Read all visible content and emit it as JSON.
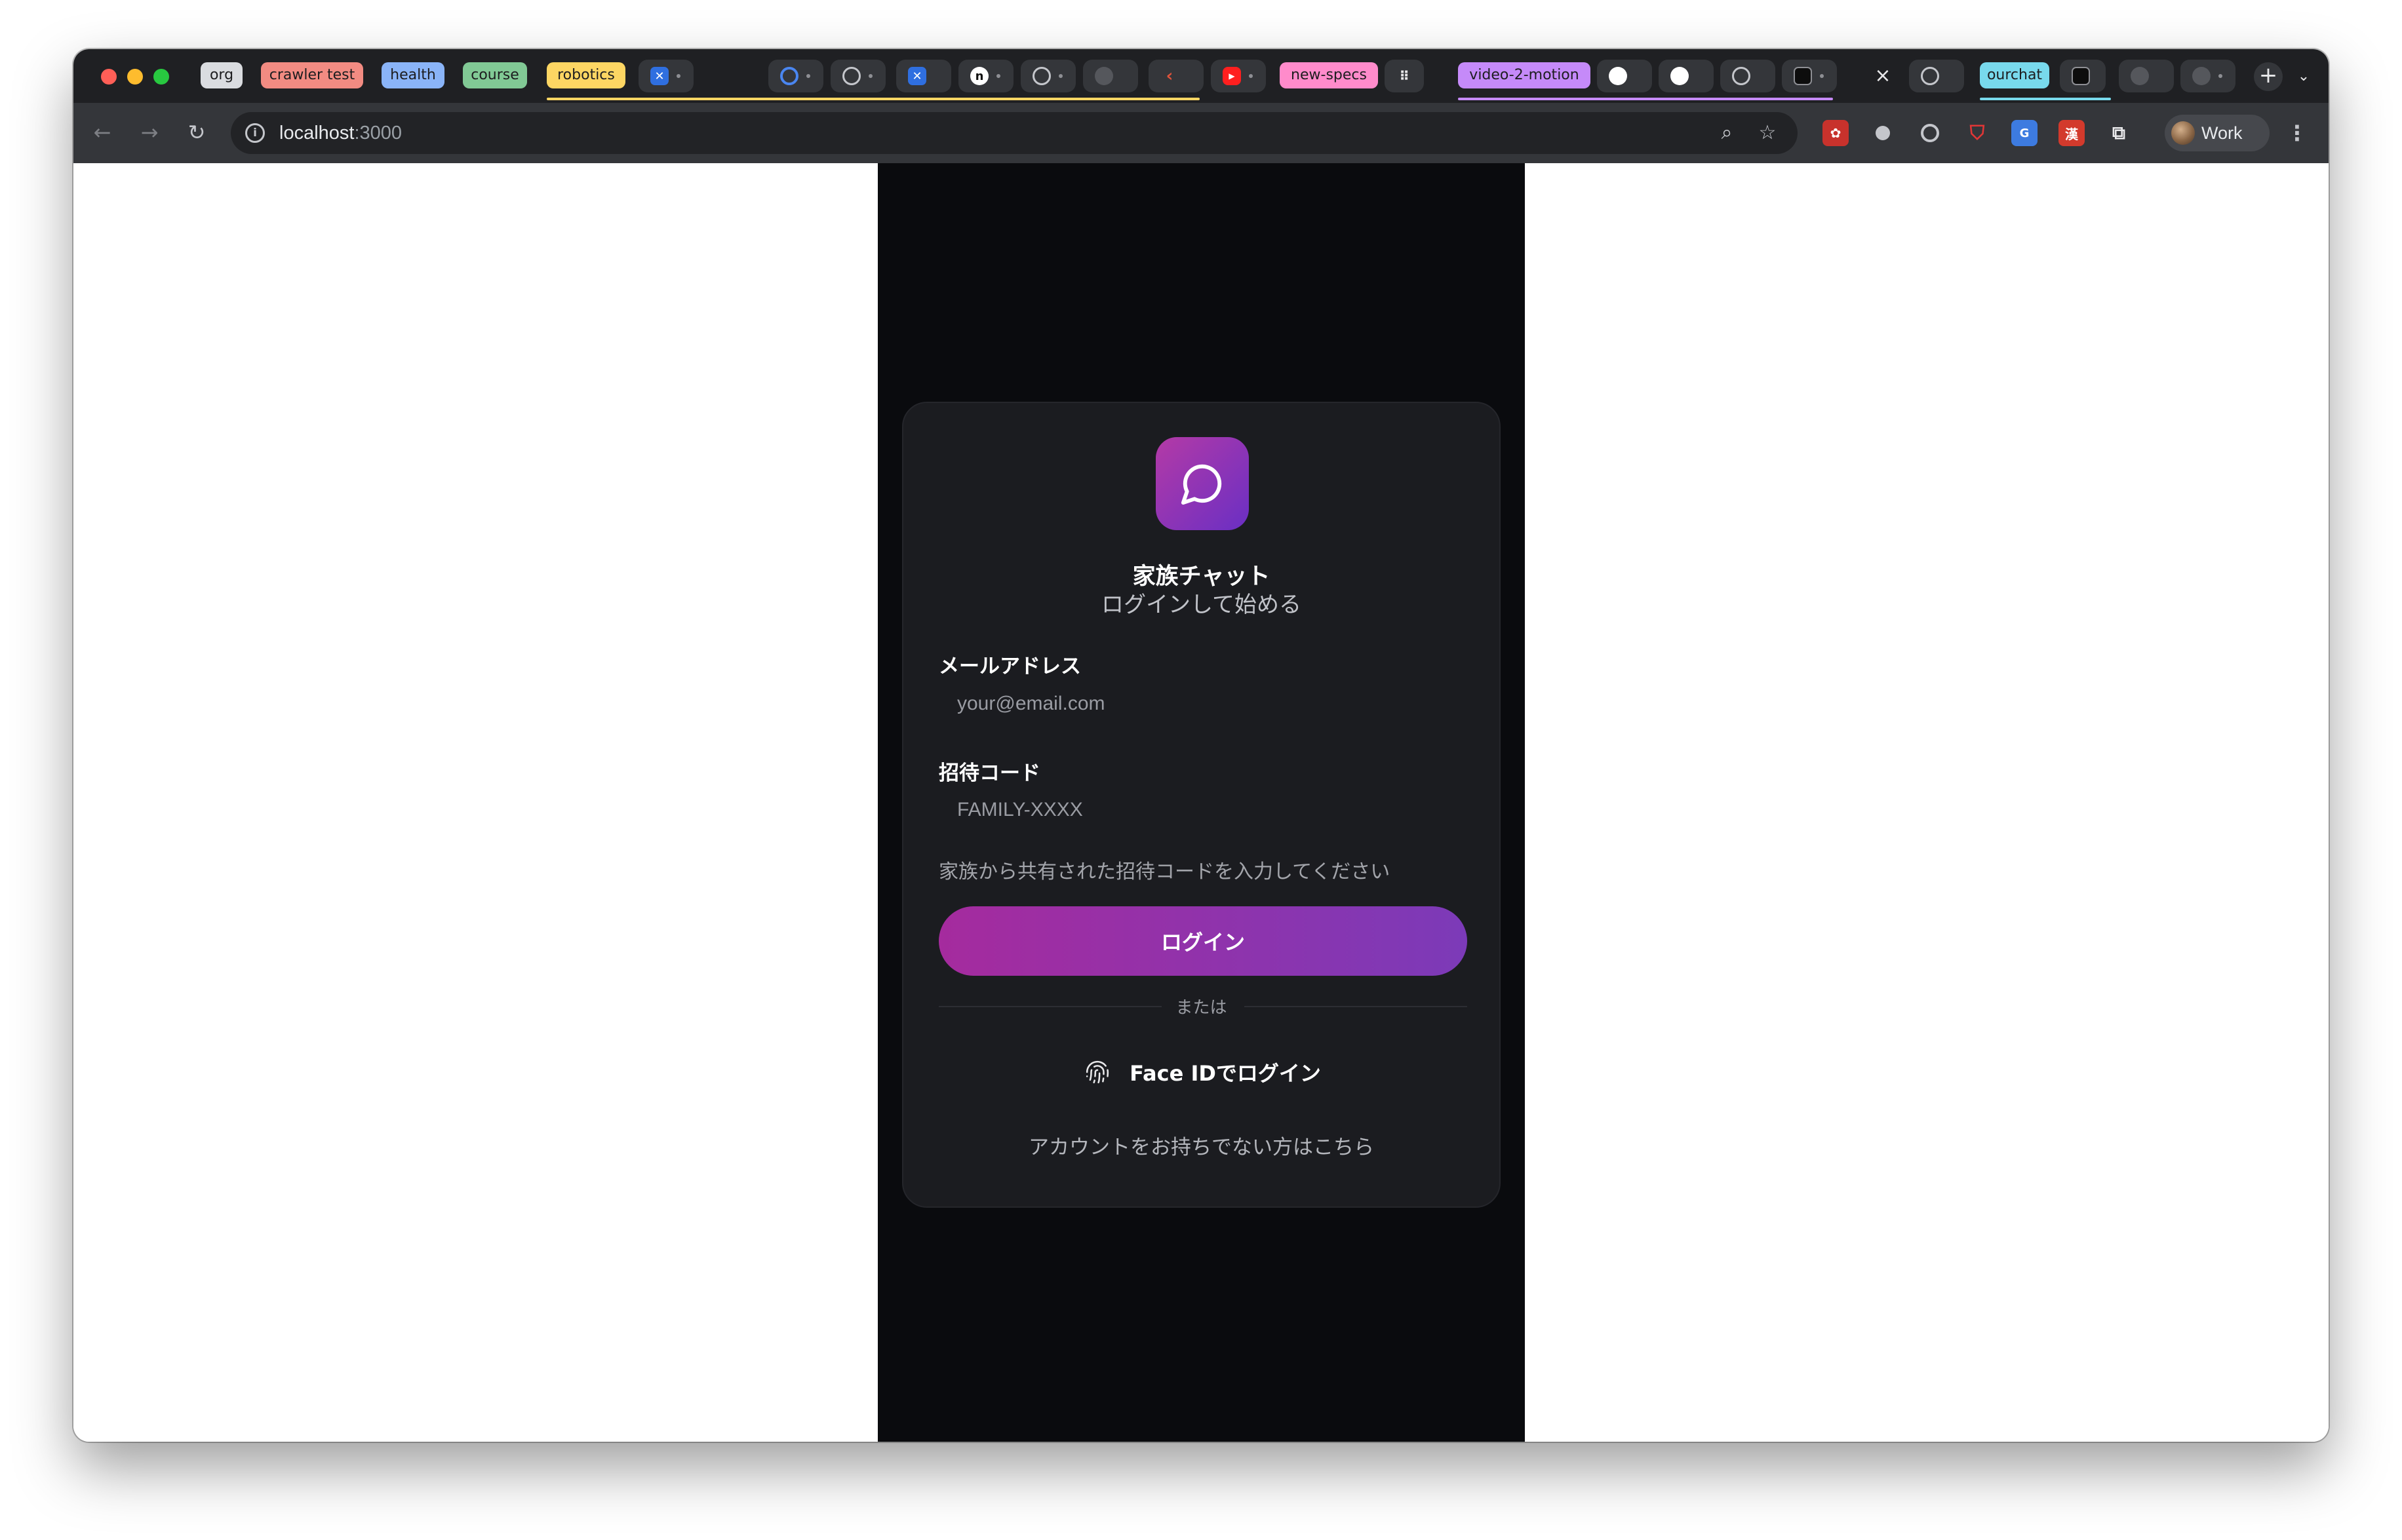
{
  "browser": {
    "tab_groups": [
      {
        "label": "org",
        "color": "#dadce0"
      },
      {
        "label": "crawler test",
        "color": "#f28b82"
      },
      {
        "label": "health",
        "color": "#8ab4f8"
      },
      {
        "label": "course",
        "color": "#81c995"
      },
      {
        "label": "robotics",
        "color": "#fdd663"
      },
      {
        "label": "new-specs",
        "color": "#ff8bcb"
      },
      {
        "label": "video-2-motion",
        "color": "#c58af9"
      },
      {
        "label": "ourchat",
        "color": "#78d9ec"
      }
    ],
    "tab_icons": [
      "jira-icon",
      "google-icon",
      "chatgpt-icon",
      "jira-icon",
      "notion-icon",
      "chatgpt-icon",
      "globe-icon",
      "claude-icon",
      "youtube-icon",
      "grid-app-icon",
      "github-icon",
      "github-icon",
      "chatgpt-icon",
      "cursor-icon",
      "chatgpt-icon",
      "cursor-icon",
      "globe-icon",
      "globe-icon"
    ],
    "close_tab_glyph": "×",
    "new_tab_glyph": "+",
    "url": {
      "host": "localhost",
      "port": ":3000"
    },
    "extension_icons": [
      "ext-red-icon",
      "ext-record-icon",
      "ext-target-icon",
      "ext-shield-icon",
      "ext-translate-icon",
      "ext-kanji-icon",
      "ext-puzzle-icon"
    ],
    "profile_name": "Work"
  },
  "app": {
    "title": "家族チャット",
    "subtitle": "ログインして始める",
    "email_label": "メールアドレス",
    "email_placeholder": "your@email.com",
    "email_value": "",
    "invite_label": "招待コード",
    "invite_placeholder": "FAMILY-XXXX",
    "invite_value": "",
    "invite_hint": "家族から共有された招待コードを入力してください",
    "login_button": "ログイン",
    "divider": "または",
    "faceid_button": "Face IDでログイン",
    "signup_link": "アカウントをお持ちでない方はこちら",
    "accent_gradient": [
      "#a52b9e",
      "#7c3ab8"
    ]
  }
}
